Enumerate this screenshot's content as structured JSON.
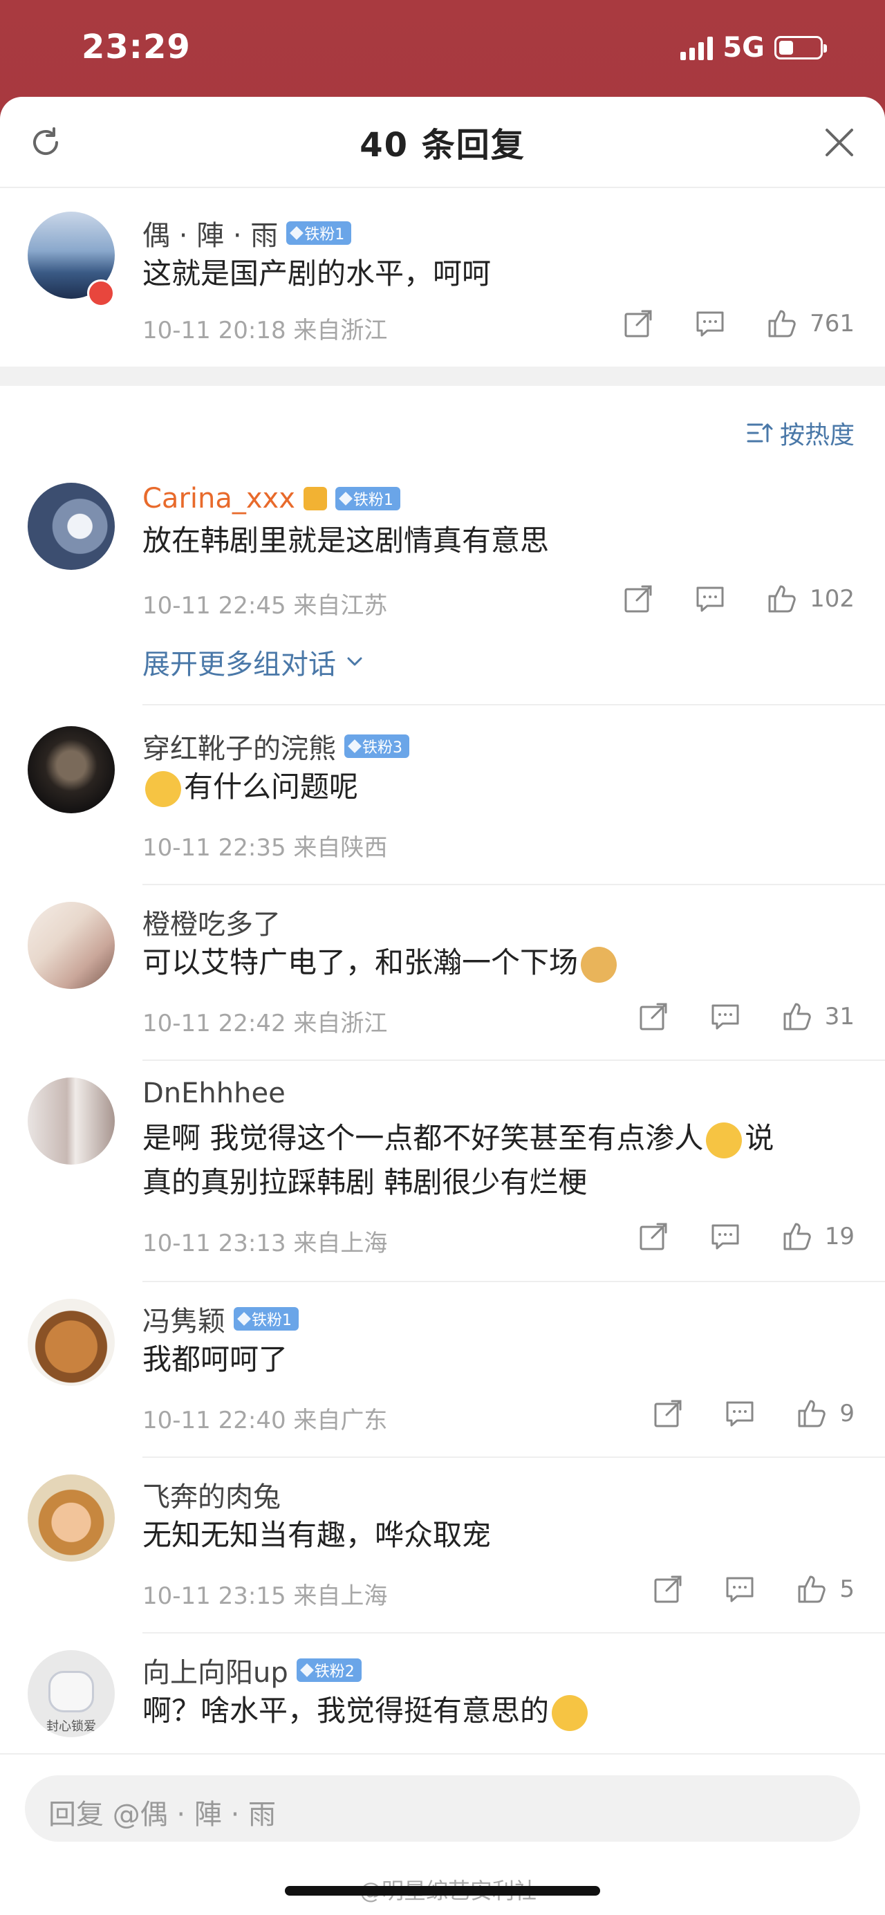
{
  "status_bar": {
    "time": "23:29",
    "network": "5G"
  },
  "sheet": {
    "title": "40 条回复"
  },
  "original_comment": {
    "name": "偶 · 陣 · 雨",
    "badge": "铁粉1",
    "text": "这就是国产剧的水平，呵呵",
    "meta": "10-11 20:18  来自浙江",
    "likes": "761"
  },
  "sort": {
    "label": "按热度"
  },
  "replies": [
    {
      "name": "Carina_xxx",
      "badge": "铁粉1",
      "text": "放在韩剧里就是这剧情真有意思",
      "meta": "10-11 22:45  来自江苏",
      "likes": "102",
      "expand": "展开更多组对话"
    },
    {
      "name": "穿红靴子的浣熊",
      "badge": "铁粉3",
      "text": "有什么问题呢",
      "meta": "10-11 22:35  来自陕西",
      "likes": ""
    },
    {
      "name": "橙橙吃多了",
      "badge": "",
      "text": "可以艾特广电了，和张瀚一个下场",
      "meta": "10-11 22:42  来自浙江",
      "likes": "31"
    },
    {
      "name": "DnEhhhee",
      "badge": "",
      "text_line1": "是啊 我觉得这个一点都不好笑甚至有点渗人",
      "text_line1_tail": "说",
      "text_line2": "真的真别拉踩韩剧 韩剧很少有烂梗",
      "meta": "10-11 23:13  来自上海",
      "likes": "19"
    },
    {
      "name": "冯隽颖",
      "badge": "铁粉1",
      "text": "我都呵呵了",
      "meta": "10-11 22:40  来自广东",
      "likes": "9"
    },
    {
      "name": "飞奔的肉兔",
      "badge": "",
      "text": "无知无知当有趣，哗众取宠",
      "meta": "10-11 23:15  来自上海",
      "likes": "5"
    },
    {
      "name": "向上向阳up",
      "badge": "铁粉2",
      "text": "啊？啥水平，我觉得挺有意思的",
      "meta": "",
      "likes": "",
      "avatar_text": "封心锁爱"
    }
  ],
  "reply_bar": {
    "placeholder": "回复 @偶 · 陣 · 雨",
    "watermark": "@明星综艺安利社"
  },
  "colors": {
    "accent_link": "#4a78a8",
    "badge_blue": "#6aa5e8",
    "vip_name": "#e86a2b",
    "status_bg": "#a93a40"
  },
  "icons": [
    "refresh-icon",
    "close-icon",
    "share-icon",
    "comment-icon",
    "like-icon",
    "sort-icon",
    "chevron-down-icon",
    "gem-icon"
  ]
}
